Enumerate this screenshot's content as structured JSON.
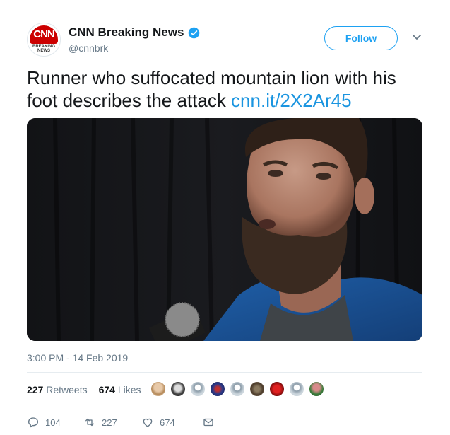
{
  "account": {
    "display_name": "CNN Breaking News",
    "handle": "@cnnbrk",
    "logo_text": "CNN",
    "logo_subtext": "BREAKING NEWS",
    "verified_color": "#1da1f2"
  },
  "follow_button": {
    "label": "Follow"
  },
  "tweet": {
    "text": "Runner who suffocated mountain lion with his foot describes the attack ",
    "link": "cnn.it/2X2Ar45",
    "timestamp": "3:00 PM - 14 Feb 2019"
  },
  "engagement": {
    "retweets_count": "227",
    "retweets_label": "Retweets",
    "likes_count": "674",
    "likes_label": "Likes"
  },
  "actions": {
    "reply_count": "104",
    "retweet_count": "227",
    "like_count": "674"
  },
  "colors": {
    "accent": "#1da1f2",
    "link": "#1b95e0",
    "secondary": "#657786",
    "brand_red": "#cc0000"
  }
}
